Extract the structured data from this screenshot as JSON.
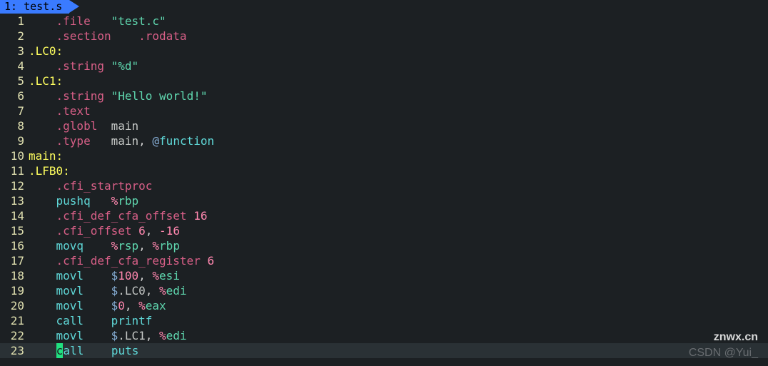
{
  "tab": {
    "index": "1",
    "name": "test.s"
  },
  "watermarks": {
    "top": "znwx.cn",
    "bottom": "CSDN @Yui_"
  },
  "cursor_line": 23,
  "lines": [
    {
      "n": 1,
      "t": [
        [
          "sp",
          "    "
        ],
        [
          "dir",
          ".file"
        ],
        [
          "sp",
          "   "
        ],
        [
          "str",
          "\"test.c\""
        ]
      ]
    },
    {
      "n": 2,
      "t": [
        [
          "sp",
          "    "
        ],
        [
          "dir",
          ".section"
        ],
        [
          "sp",
          "    "
        ],
        [
          "dir",
          ".rodata"
        ]
      ]
    },
    {
      "n": 3,
      "t": [
        [
          "lbl",
          ".LC0:"
        ]
      ]
    },
    {
      "n": 4,
      "t": [
        [
          "sp",
          "    "
        ],
        [
          "dir",
          ".string"
        ],
        [
          "sp",
          " "
        ],
        [
          "str",
          "\"%d\""
        ]
      ]
    },
    {
      "n": 5,
      "t": [
        [
          "lbl",
          ".LC1:"
        ]
      ]
    },
    {
      "n": 6,
      "t": [
        [
          "sp",
          "    "
        ],
        [
          "dir",
          ".string"
        ],
        [
          "sp",
          " "
        ],
        [
          "str",
          "\"Hello world!\""
        ]
      ]
    },
    {
      "n": 7,
      "t": [
        [
          "sp",
          "    "
        ],
        [
          "dir",
          ".text"
        ]
      ]
    },
    {
      "n": 8,
      "t": [
        [
          "sp",
          "    "
        ],
        [
          "dir",
          ".globl"
        ],
        [
          "sp",
          "  "
        ],
        [
          "id",
          "main"
        ]
      ]
    },
    {
      "n": 9,
      "t": [
        [
          "sp",
          "    "
        ],
        [
          "dir",
          ".type"
        ],
        [
          "sp",
          "   "
        ],
        [
          "id",
          "main"
        ],
        [
          "pale",
          ", "
        ],
        [
          "at",
          "@"
        ],
        [
          "func",
          "function"
        ]
      ]
    },
    {
      "n": 10,
      "t": [
        [
          "lbl",
          "main:"
        ]
      ]
    },
    {
      "n": 11,
      "t": [
        [
          "lbl",
          ".LFB0:"
        ]
      ]
    },
    {
      "n": 12,
      "t": [
        [
          "sp",
          "    "
        ],
        [
          "dir",
          ".cfi_startproc"
        ]
      ]
    },
    {
      "n": 13,
      "t": [
        [
          "sp",
          "    "
        ],
        [
          "kw",
          "pushq"
        ],
        [
          "sp",
          "   "
        ],
        [
          "pct",
          "%"
        ],
        [
          "reg",
          "rbp"
        ]
      ]
    },
    {
      "n": 14,
      "t": [
        [
          "sp",
          "    "
        ],
        [
          "dir",
          ".cfi_def_cfa_offset"
        ],
        [
          "sp",
          " "
        ],
        [
          "num",
          "16"
        ]
      ]
    },
    {
      "n": 15,
      "t": [
        [
          "sp",
          "    "
        ],
        [
          "dir",
          ".cfi_offset"
        ],
        [
          "sp",
          " "
        ],
        [
          "num",
          "6"
        ],
        [
          "pale",
          ", "
        ],
        [
          "num",
          "-16"
        ]
      ]
    },
    {
      "n": 16,
      "t": [
        [
          "sp",
          "    "
        ],
        [
          "kw",
          "movq"
        ],
        [
          "sp",
          "    "
        ],
        [
          "pct",
          "%"
        ],
        [
          "reg",
          "rsp"
        ],
        [
          "pale",
          ", "
        ],
        [
          "pct",
          "%"
        ],
        [
          "reg",
          "rbp"
        ]
      ]
    },
    {
      "n": 17,
      "t": [
        [
          "sp",
          "    "
        ],
        [
          "dir",
          ".cfi_def_cfa_register"
        ],
        [
          "sp",
          " "
        ],
        [
          "num",
          "6"
        ]
      ]
    },
    {
      "n": 18,
      "t": [
        [
          "sp",
          "    "
        ],
        [
          "kw",
          "movl"
        ],
        [
          "sp",
          "    "
        ],
        [
          "dol",
          "$"
        ],
        [
          "num",
          "100"
        ],
        [
          "pale",
          ", "
        ],
        [
          "pct",
          "%"
        ],
        [
          "reg",
          "esi"
        ]
      ]
    },
    {
      "n": 19,
      "t": [
        [
          "sp",
          "    "
        ],
        [
          "kw",
          "movl"
        ],
        [
          "sp",
          "    "
        ],
        [
          "dol",
          "$"
        ],
        [
          "id",
          ".LC0"
        ],
        [
          "pale",
          ", "
        ],
        [
          "pct",
          "%"
        ],
        [
          "reg",
          "edi"
        ]
      ]
    },
    {
      "n": 20,
      "t": [
        [
          "sp",
          "    "
        ],
        [
          "kw",
          "movl"
        ],
        [
          "sp",
          "    "
        ],
        [
          "dol",
          "$"
        ],
        [
          "num",
          "0"
        ],
        [
          "pale",
          ", "
        ],
        [
          "pct",
          "%"
        ],
        [
          "reg",
          "eax"
        ]
      ]
    },
    {
      "n": 21,
      "t": [
        [
          "sp",
          "    "
        ],
        [
          "kw",
          "call"
        ],
        [
          "sp",
          "    "
        ],
        [
          "kw",
          "printf"
        ]
      ]
    },
    {
      "n": 22,
      "t": [
        [
          "sp",
          "    "
        ],
        [
          "kw",
          "movl"
        ],
        [
          "sp",
          "    "
        ],
        [
          "dol",
          "$"
        ],
        [
          "id",
          ".LC1"
        ],
        [
          "pale",
          ", "
        ],
        [
          "pct",
          "%"
        ],
        [
          "reg",
          "edi"
        ]
      ]
    },
    {
      "n": 23,
      "t": [
        [
          "sp",
          "    "
        ],
        [
          "cursor",
          "c"
        ],
        [
          "kw",
          "all"
        ],
        [
          "sp",
          "    "
        ],
        [
          "kw",
          "puts"
        ]
      ]
    }
  ]
}
